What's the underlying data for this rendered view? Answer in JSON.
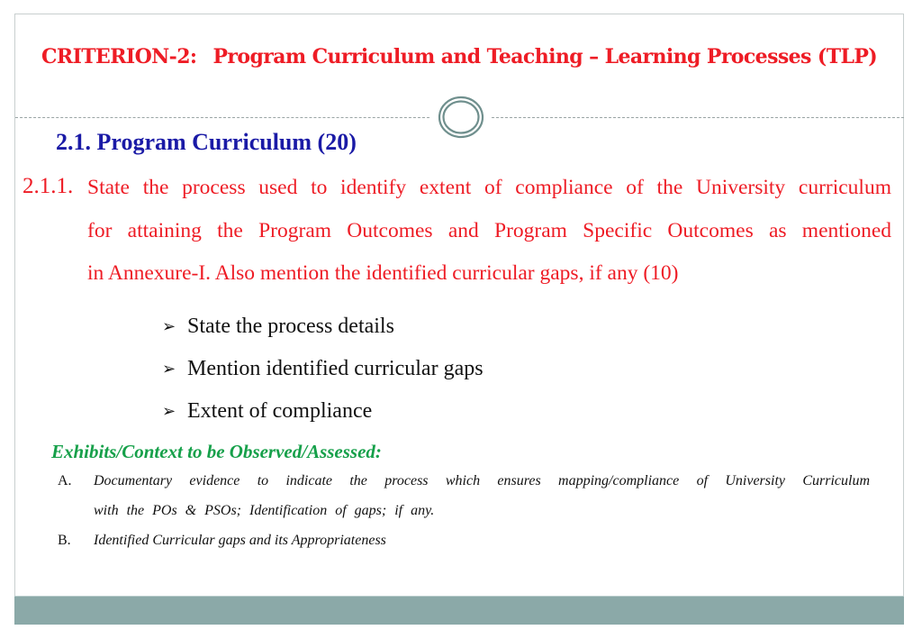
{
  "slide": {
    "title": {
      "criterion": "CRITERION-2:",
      "text": "Program Curriculum and Teaching – Learning Processes (TLP)"
    },
    "section_heading": "2.1. Program Curriculum (20)",
    "question": {
      "number": "2.1.1.",
      "lines": [
        "State the process used to identify extent of compliance of the University curriculum",
        "for attaining the Program Outcomes and Program Specific Outcomes as mentioned",
        "in Annexure-I. Also mention the identified curricular gaps, if any (10)"
      ]
    },
    "bullets": [
      {
        "icon": "arrow-bullet-icon",
        "glyph": "➢",
        "text": "State the process details"
      },
      {
        "icon": "arrow-bullet-icon",
        "glyph": "➢",
        "text": "Mention identified curricular gaps"
      },
      {
        "icon": "arrow-bullet-icon",
        "glyph": "➢",
        "text": "Extent of compliance"
      }
    ],
    "exhibits": {
      "heading": "Exhibits/Context to be Observed/Assessed:",
      "items": [
        {
          "letter": "A.",
          "lines": [
            "Documentary evidence to indicate the process which ensures mapping/compliance of University Curriculum",
            "with the POs & PSOs; Identification of gaps; if any."
          ]
        },
        {
          "letter": "B.",
          "lines": [
            "Identified Curricular gaps and its Appropriateness"
          ]
        }
      ]
    },
    "colors": {
      "title": "#ee1c25",
      "section_heading": "#1a1aa6",
      "question": "#ee1c25",
      "exhibits_heading": "#16a04a",
      "footer_bar": "#8ba9a8",
      "ring": "#6f8f8d"
    }
  }
}
